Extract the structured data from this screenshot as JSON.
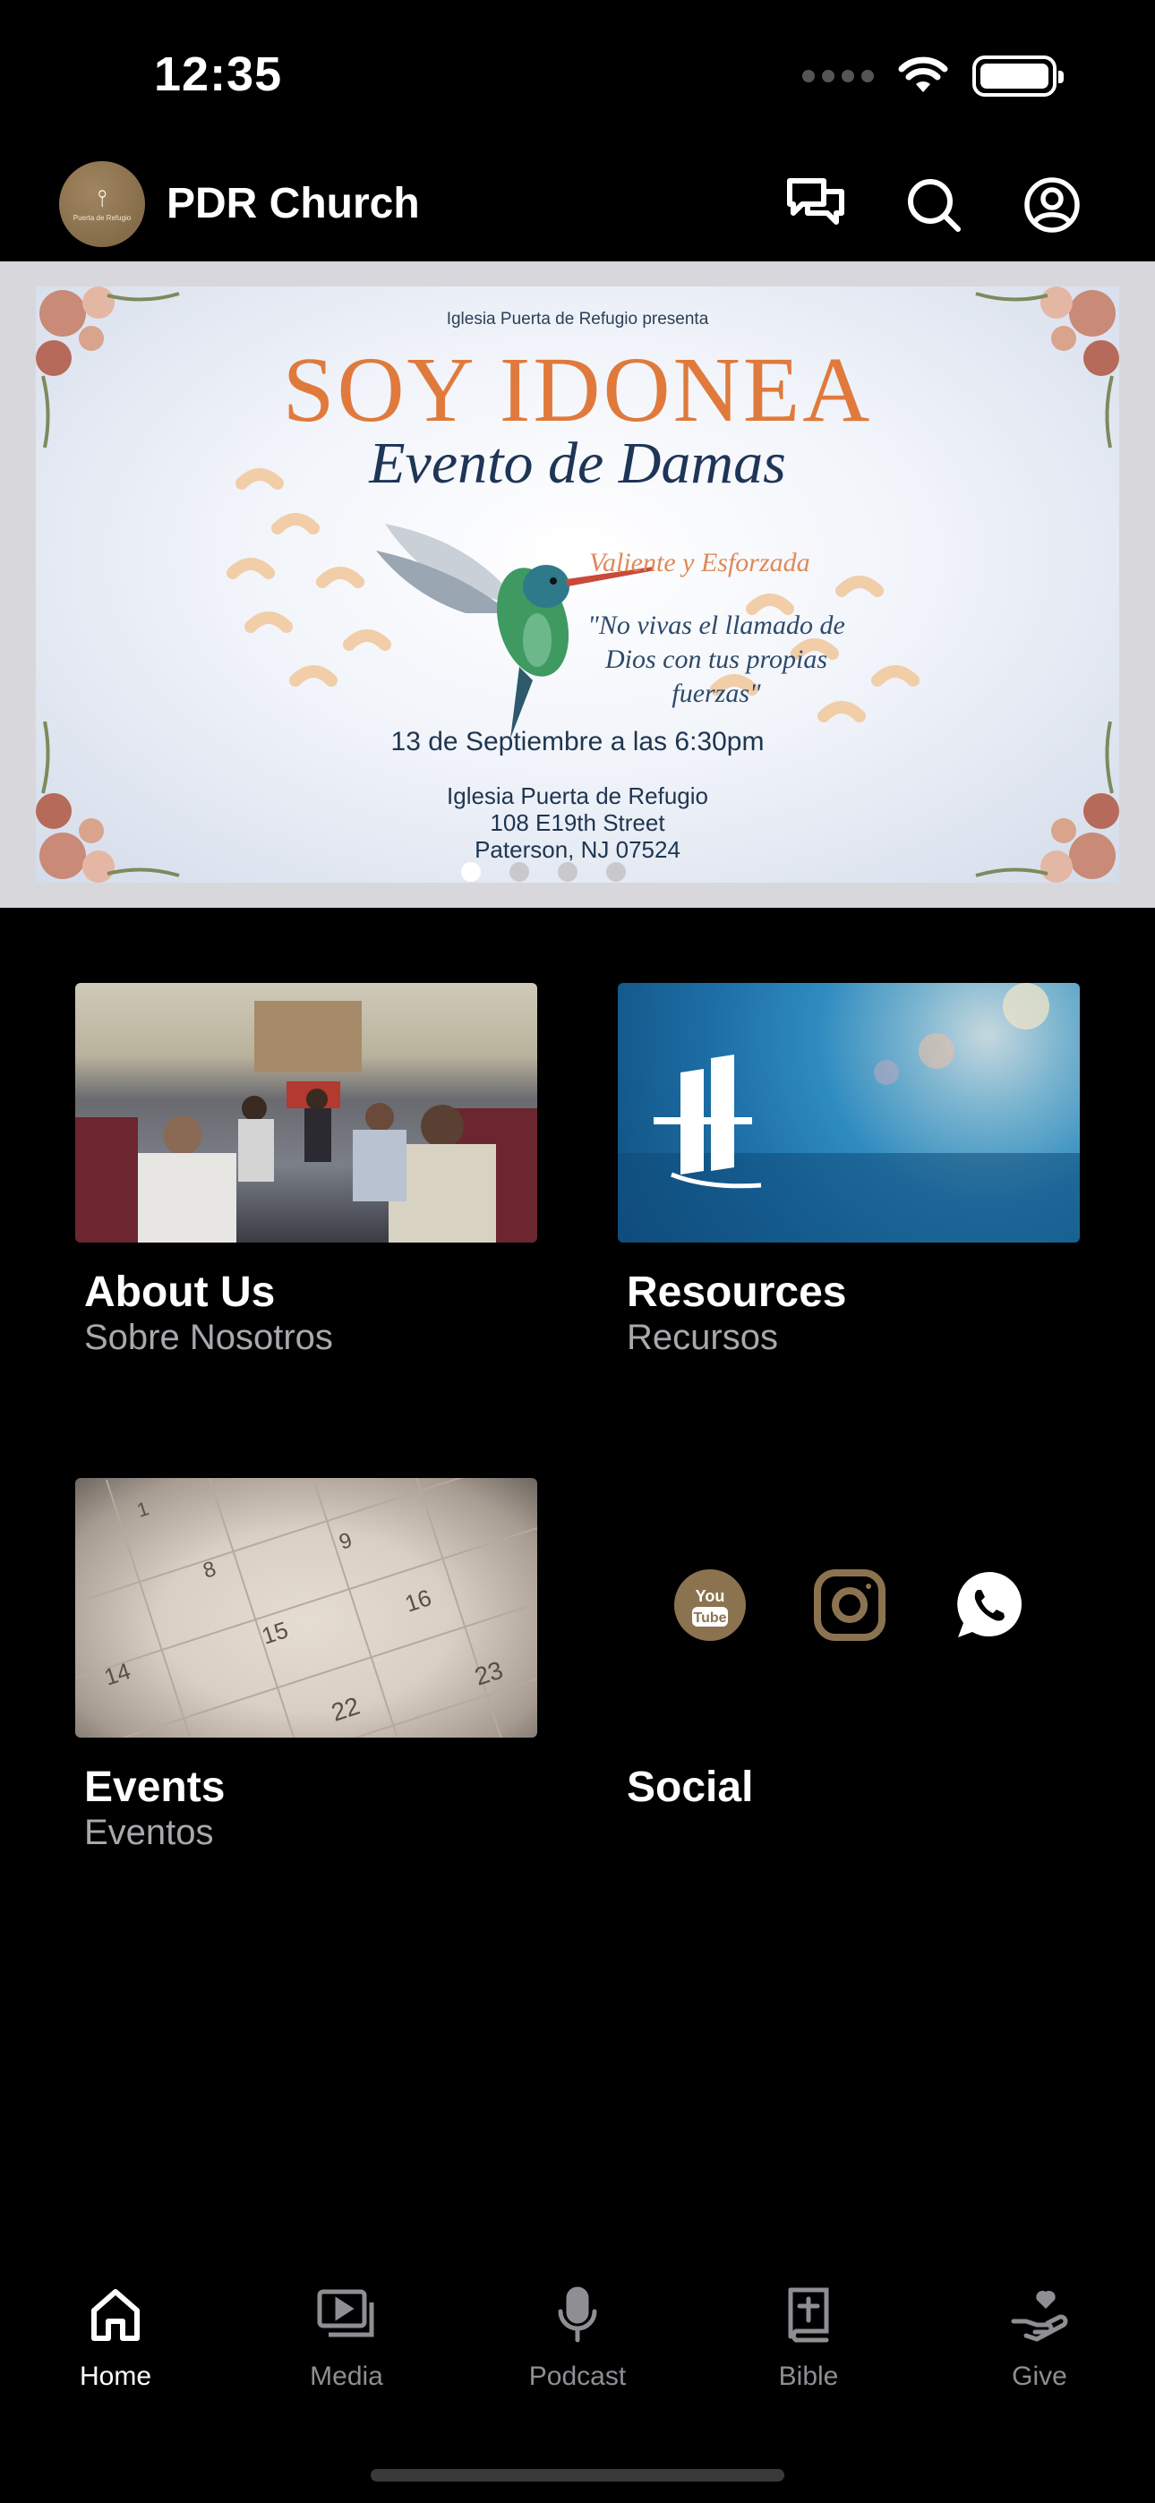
{
  "status_bar": {
    "time": "12:35"
  },
  "header": {
    "title": "PDR Church",
    "logo_text": "Puerta de Refugio"
  },
  "banner": {
    "presents": "Iglesia Puerta de Refugio presenta",
    "title": "SOY IDONEA",
    "subtitle": "Evento de Damas",
    "tagline": "Valiente y Esforzada",
    "quote": "\"No vivas el llamado de Dios con tus propias fuerzas\"",
    "date": "13 de Septiembre a las 6:30pm",
    "venue_line1": "Iglesia Puerta de Refugio",
    "venue_line2": "108 E19th Street",
    "venue_line3": "Paterson, NJ 07524",
    "page_count": 4,
    "active_page": 1
  },
  "tiles": [
    {
      "title": "About Us",
      "subtitle": "Sobre Nosotros"
    },
    {
      "title": "Resources",
      "subtitle": "Recursos"
    },
    {
      "title": "Events",
      "subtitle": "Eventos"
    },
    {
      "title": "Social",
      "subtitle": ""
    }
  ],
  "events_calendar": [
    "1",
    "8",
    "9",
    "15",
    "16",
    "14",
    "22",
    "23"
  ],
  "social_icons": [
    "youtube-icon",
    "instagram-icon",
    "whatsapp-icon"
  ],
  "tab_bar": [
    {
      "label": "Home",
      "icon": "home-icon",
      "active": true
    },
    {
      "label": "Media",
      "icon": "media-icon",
      "active": false
    },
    {
      "label": "Podcast",
      "icon": "microphone-icon",
      "active": false
    },
    {
      "label": "Bible",
      "icon": "bible-icon",
      "active": false
    },
    {
      "label": "Give",
      "icon": "give-icon",
      "active": false
    }
  ],
  "colors": {
    "background": "#000000",
    "accent_gold": "#8c7350",
    "banner_orange": "#e07a3c",
    "inactive_tab": "#8e8e93"
  }
}
